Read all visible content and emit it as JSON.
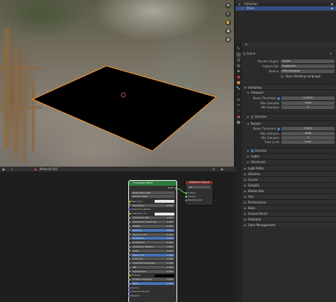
{
  "outliner": {
    "collection": "Collection",
    "plane": "Plane"
  },
  "properties": {
    "scene_label": "Scene",
    "render_engine_label": "Render Engine",
    "render_engine": "Cycles",
    "feature_set_label": "Feature Set",
    "feature_set": "Supported",
    "device_label": "Device",
    "device": "GPU Compute",
    "osl_label": "Open Shading Language",
    "sampling": "Sampling",
    "viewport": "Viewport",
    "vp_noise_threshold_label": "Noise Threshold",
    "vp_noise_threshold": "0.1000",
    "vp_max_samples_label": "Max Samples",
    "vp_max_samples": "1024",
    "vp_min_samples_label": "Min Samples",
    "vp_min_samples": "0",
    "denoise": "Denoise",
    "render": "Render",
    "r_noise_threshold_label": "Noise Threshold",
    "r_noise_threshold": "0.0100",
    "r_max_samples_label": "Max Samples",
    "r_max_samples": "4096",
    "r_min_samples_label": "Min Samples",
    "r_min_samples": "0",
    "time_limit_label": "Time Limit",
    "time_limit": "0 sec",
    "sub_denoise": "Denoise",
    "lights": "Lights",
    "advanced": "Advanced",
    "sections": [
      "Light Paths",
      "Volumes",
      "Curves",
      "Simplify",
      "Motion Blur",
      "Film",
      "Performance",
      "Bake",
      "Grease Pencil",
      "Freestyle",
      "Color Management"
    ]
  },
  "node_editor": {
    "material_name": "Material.001"
  },
  "bsdf_node": {
    "title": "Principled BSDF",
    "bsdf_out": "BSDF",
    "distribution": "Multiscatter GGX",
    "subsurface_method": "Random Walk",
    "rows": [
      {
        "label": "Base Color",
        "value": "",
        "kind": "color-white"
      },
      {
        "label": "Subsurface",
        "value": "0.000",
        "kind": "bar"
      },
      {
        "label": "Subsurface Radius",
        "value": "",
        "kind": "vector"
      },
      {
        "label": "Subsurface Co...",
        "value": "",
        "kind": "color-white"
      },
      {
        "label": "Subsurface IOR",
        "value": "1.400",
        "kind": "bar"
      },
      {
        "label": "Subsurface Anisotropy",
        "value": "0.000",
        "kind": "bar"
      },
      {
        "label": "Metallic",
        "value": "0.000",
        "kind": "bar"
      },
      {
        "label": "Specular",
        "value": "0.500",
        "kind": "blue"
      },
      {
        "label": "Specular Tint",
        "value": "0.000",
        "kind": "bar"
      },
      {
        "label": "Roughness",
        "value": "0.500",
        "kind": "blue"
      },
      {
        "label": "Anisotropic",
        "value": "0.000",
        "kind": "bar"
      },
      {
        "label": "Anisotropic Rotation",
        "value": "0.000",
        "kind": "bar"
      },
      {
        "label": "Sheen",
        "value": "0.000",
        "kind": "bar"
      },
      {
        "label": "Sheen Tint",
        "value": "0.500",
        "kind": "blue"
      },
      {
        "label": "Clearcoat",
        "value": "0.000",
        "kind": "bar"
      },
      {
        "label": "Clearcoat Roughness",
        "value": "0.030",
        "kind": "bar"
      },
      {
        "label": "IOR",
        "value": "1.450",
        "kind": "bar"
      },
      {
        "label": "Transmission",
        "value": "0.000",
        "kind": "bar"
      },
      {
        "label": "Emission",
        "value": "",
        "kind": "color-black"
      },
      {
        "label": "Emission Strength",
        "value": "1.000",
        "kind": "bar"
      },
      {
        "label": "Alpha",
        "value": "1.000",
        "kind": "blue"
      },
      {
        "label": "Normal",
        "value": "",
        "kind": "socket"
      },
      {
        "label": "Clearcoat Normal",
        "value": "",
        "kind": "socket"
      },
      {
        "label": "Tangent",
        "value": "",
        "kind": "socket"
      }
    ]
  },
  "output_node": {
    "title": "Material Output",
    "target": "All",
    "surface": "Surface",
    "volume": "Volume",
    "displacement": "Displacement"
  },
  "colors": {
    "accent": "#4772b3",
    "bsdf_header": "#2e7a3e",
    "output_header": "#7a2e2e",
    "socket_shader": "#63c763",
    "socket_color": "#c7c729",
    "socket_float": "#a1a1a1",
    "socket_vector": "#6363c7",
    "selection_outline": "#ff9a30"
  }
}
